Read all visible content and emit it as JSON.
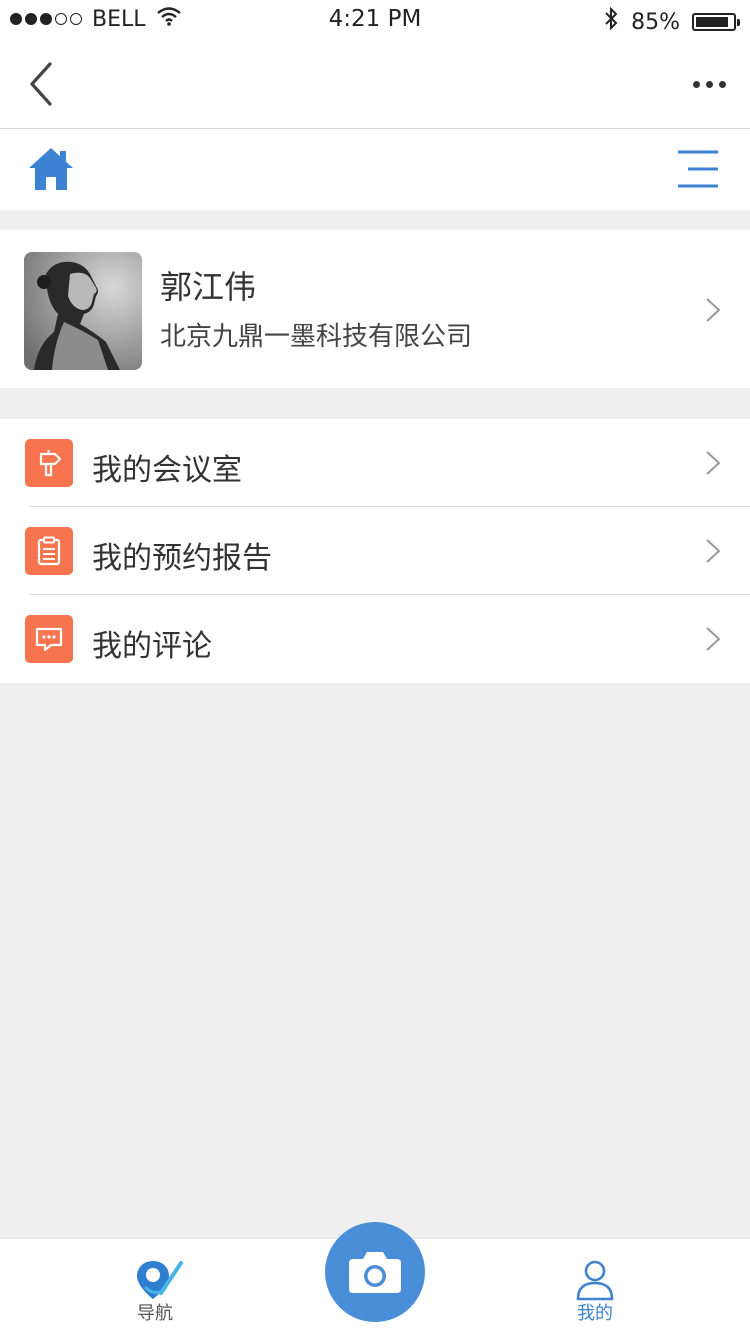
{
  "status_bar": {
    "carrier": "BELL",
    "time": "4:21 PM",
    "battery": "85%",
    "battery_level": 0.85,
    "signal_bars": 3,
    "signal_total": 5
  },
  "profile": {
    "name": "郭江伟",
    "company": "北京九鼎一墨科技有限公司"
  },
  "menu": {
    "items": [
      {
        "label": "我的会议室",
        "icon": "signpost-icon"
      },
      {
        "label": "我的预约报告",
        "icon": "clipboard-icon"
      },
      {
        "label": "我的评论",
        "icon": "comment-icon"
      }
    ]
  },
  "tabbar": {
    "nav_label": "导航",
    "mine_label": "我的",
    "active": "我的"
  },
  "colors": {
    "accent_blue": "#3e82d3",
    "menu_icon_orange": "#f8744f",
    "camera_blue": "#4a8ed8",
    "background": "#efefef"
  }
}
